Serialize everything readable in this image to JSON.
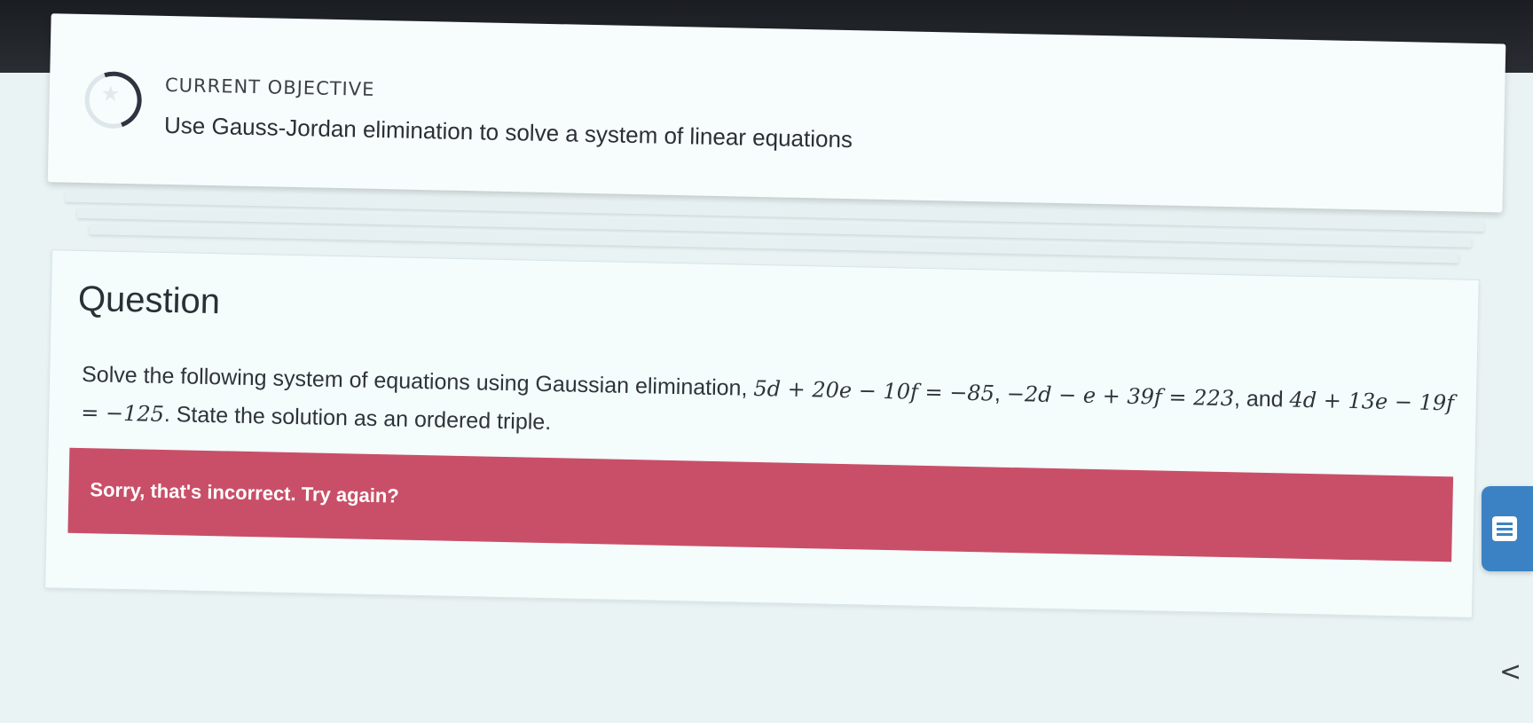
{
  "objective": {
    "label": "CURRENT OBJECTIVE",
    "title": "Use Gauss-Jordan elimination to solve a system of linear equations"
  },
  "question": {
    "heading": "Question",
    "intro": "Solve the following system of equations using Gaussian elimination,",
    "eq1": "5d + 20e − 10f = −85",
    "sep1": ",",
    "eq2": "−2d − e + 39f = 223",
    "sep2": ", and",
    "eq3": "4d + 13e − 19f = −125",
    "outro": ". State the solution as an ordered triple."
  },
  "feedback": {
    "text": "Sorry, that's incorrect. Try again?",
    "color": "#c94f68"
  },
  "icons": {
    "progress": "progress-ring-icon",
    "star": "star-icon",
    "side_tab": "notes-icon",
    "chevron": "chevron-left-icon"
  },
  "side_tab": {
    "color": "#3b82c4"
  },
  "chevron": {
    "glyph": "<"
  }
}
